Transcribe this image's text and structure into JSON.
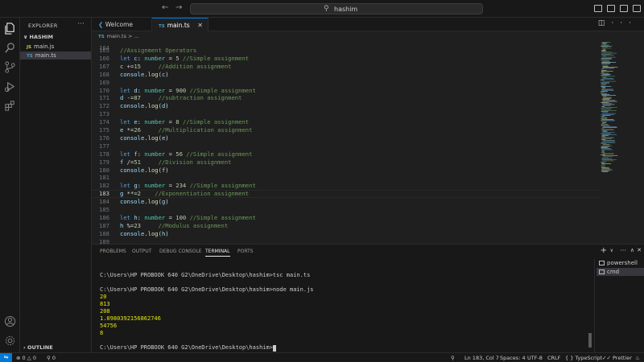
{
  "titlebar": {
    "search_text": "hashim"
  },
  "sidebar": {
    "header": "EXPLORER",
    "folder": "HASHIM",
    "files": [
      {
        "icon": "JS",
        "name": "main.js"
      },
      {
        "icon": "TS",
        "name": "main.ts"
      }
    ],
    "outline": "OUTLINE"
  },
  "tabs": [
    {
      "label": "Welcome"
    },
    {
      "icon": "TS",
      "label": "main.ts"
    }
  ],
  "breadcrumb": {
    "icon": "TS",
    "file": "main.ts",
    "rest": "> ..."
  },
  "editor": {
    "top_partial_line": "164",
    "lines": [
      {
        "n": "165",
        "code": "//Assignment Operators"
      },
      {
        "n": "166",
        "code": "let c: number = 5 //Simple assignment"
      },
      {
        "n": "167",
        "code": "c +=15     //Addition assignment"
      },
      {
        "n": "168",
        "code": "console.log(c)"
      },
      {
        "n": "169",
        "code": ""
      },
      {
        "n": "170",
        "code": "let d: number = 900 //Simple assignment"
      },
      {
        "n": "171",
        "code": "d -=87     //subtraction assignment"
      },
      {
        "n": "172",
        "code": "console.log(d)"
      },
      {
        "n": "173",
        "code": ""
      },
      {
        "n": "174",
        "code": "let e: number = 8 //Simple assignment"
      },
      {
        "n": "175",
        "code": "e *=26     //Multiplication assignment"
      },
      {
        "n": "176",
        "code": "console.log(e)"
      },
      {
        "n": "177",
        "code": ""
      },
      {
        "n": "178",
        "code": "let f: number = 56 //Simple assignment"
      },
      {
        "n": "179",
        "code": "f /=51     //Division assignment"
      },
      {
        "n": "180",
        "code": "console.log(f)"
      },
      {
        "n": "181",
        "code": ""
      },
      {
        "n": "182",
        "code": "let g: number = 234 //Simple assignment"
      },
      {
        "n": "183",
        "code": "g **=2    //Exponentiation assignment"
      },
      {
        "n": "184",
        "code": "console.log(g)"
      },
      {
        "n": "185",
        "code": ""
      },
      {
        "n": "186",
        "code": "let h: number = 100 //Simple assignment"
      },
      {
        "n": "187",
        "code": "h %=23     //Modulus assignment"
      },
      {
        "n": "188",
        "code": "console.log(h)"
      },
      {
        "n": "189",
        "code": ""
      }
    ]
  },
  "panel": {
    "tabs": [
      "PROBLEMS",
      "OUTPUT",
      "DEBUG CONSOLE",
      "TERMINAL",
      "PORTS"
    ],
    "terminal_lines": [
      {
        "kind": "prompt",
        "text": "C:\\Users\\HP PROBOOK 640 G2\\OneDrive\\Desktop\\hashim>tsc main.ts"
      },
      {
        "kind": "blank",
        "text": ""
      },
      {
        "kind": "prompt",
        "text": "C:\\Users\\HP PROBOOK 640 G2\\OneDrive\\Desktop\\hashim>node main.js"
      },
      {
        "kind": "out",
        "text": "20"
      },
      {
        "kind": "out",
        "text": "813"
      },
      {
        "kind": "out",
        "text": "208"
      },
      {
        "kind": "out",
        "text": "1.0980392156862746"
      },
      {
        "kind": "out",
        "text": "54756"
      },
      {
        "kind": "out",
        "text": "8"
      },
      {
        "kind": "blank",
        "text": ""
      },
      {
        "kind": "prompt",
        "text": "C:\\Users\\HP PROBOOK 640 G2\\OneDrive\\Desktop\\hashim>"
      }
    ],
    "terminals": [
      "powershell",
      "cmd"
    ]
  },
  "statusbar": {
    "errors": "0",
    "warnings": "0",
    "ports": "0",
    "position": "Ln 183, Col 7",
    "spaces": "Spaces: 4",
    "encoding": "UTF-8",
    "eol": "CRLF",
    "language": "TypeScript",
    "formatter": "Prettier"
  },
  "colors": {
    "accent": "#0078d4",
    "keyword": "#569cd6",
    "variable": "#9cdcfe",
    "type": "#4ec9b0",
    "number": "#b5cea8",
    "comment": "#6a9955",
    "terminal_output": "#e5e510"
  }
}
